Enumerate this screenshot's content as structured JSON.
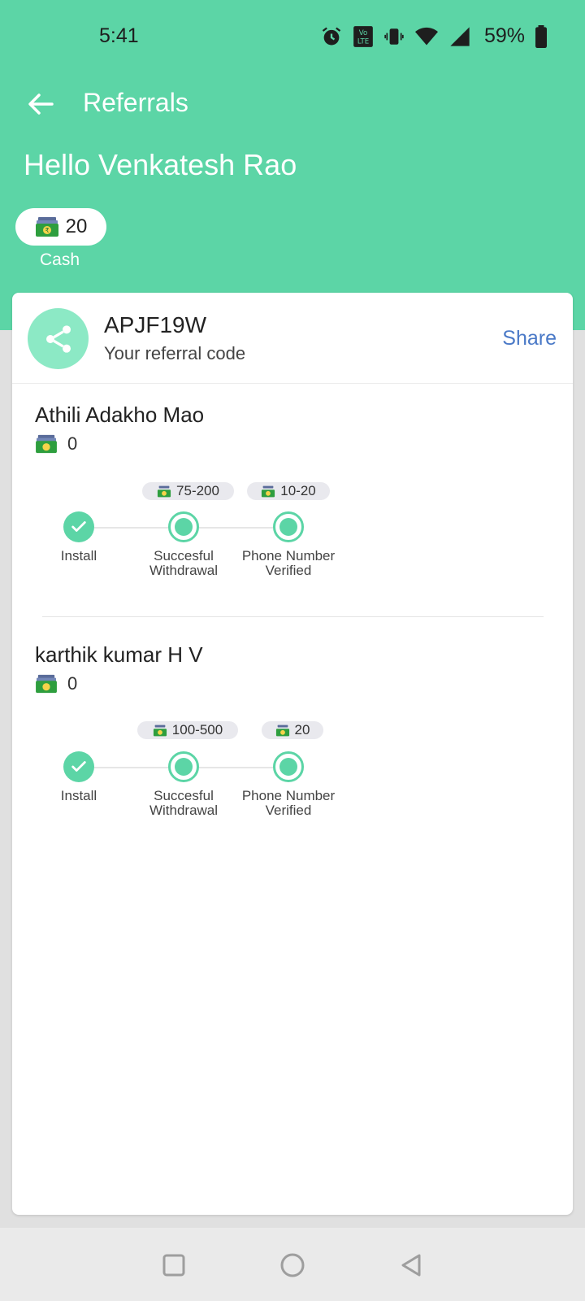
{
  "status_bar": {
    "time": "5:41",
    "battery": "59%"
  },
  "app_bar": {
    "title": "Referrals"
  },
  "greeting": "Hello Venkatesh Rao",
  "wallet": {
    "amount": "20",
    "label": "Cash"
  },
  "referral_code": {
    "code": "APJF19W",
    "label": "Your referral code",
    "share_label": "Share"
  },
  "referrals": [
    {
      "name": "Athili Adakho Mao",
      "earned": "0",
      "steps": [
        {
          "label_line1": "Install",
          "label_line2": "",
          "reward": "",
          "done": true
        },
        {
          "label_line1": "Succesful",
          "label_line2": "Withdrawal",
          "reward": "75-200",
          "done": false
        },
        {
          "label_line1": "Phone Number",
          "label_line2": "Verified",
          "reward": "10-20",
          "done": false
        }
      ]
    },
    {
      "name": "karthik kumar H V",
      "earned": "0",
      "steps": [
        {
          "label_line1": "Install",
          "label_line2": "",
          "reward": "",
          "done": true
        },
        {
          "label_line1": "Succesful",
          "label_line2": "Withdrawal",
          "reward": "100-500",
          "done": false
        },
        {
          "label_line1": "Phone Number",
          "label_line2": "Verified",
          "reward": "20",
          "done": false
        }
      ]
    }
  ],
  "colors": {
    "accent": "#5cd5a6",
    "share_circle": "#8ce9c5",
    "link": "#4a79c7",
    "cash_green": "#2e9e3e"
  },
  "icons": {
    "back": "arrow-left-icon",
    "share": "share-icon",
    "cash": "cash-stack-icon",
    "check": "check-icon"
  }
}
